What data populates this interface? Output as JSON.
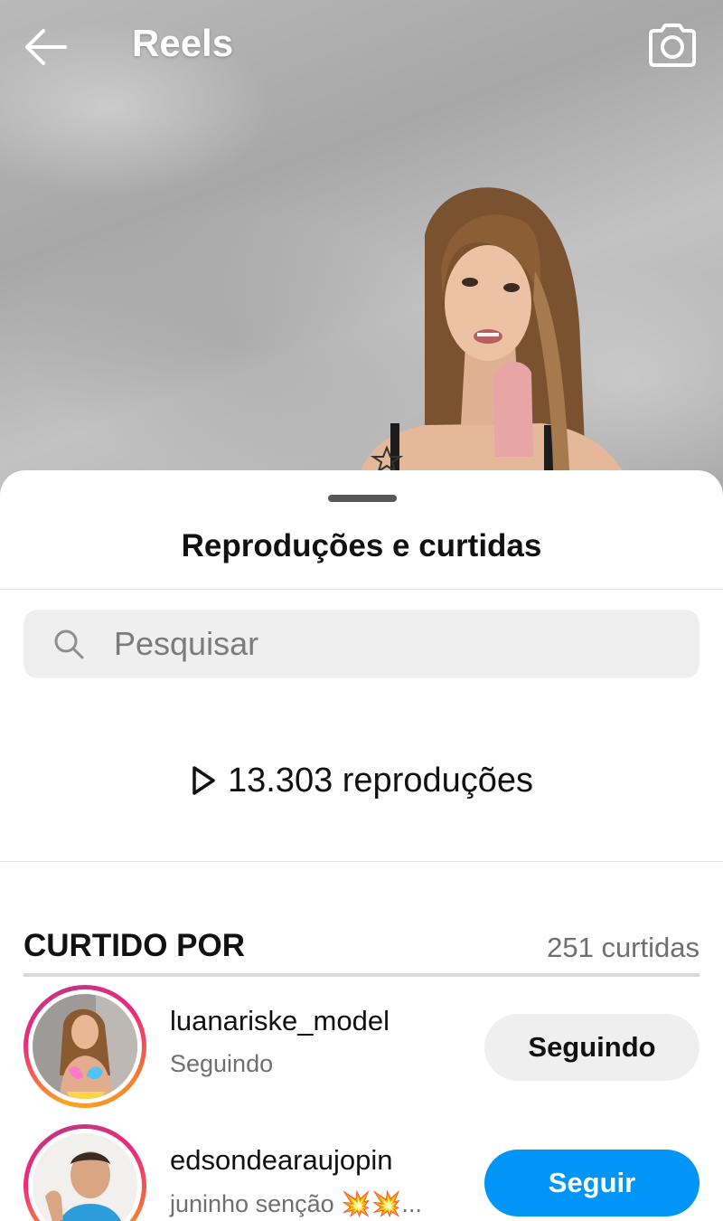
{
  "header": {
    "title": "Reels",
    "back_icon": "arrow-left-icon",
    "camera_icon": "camera-icon"
  },
  "sheet": {
    "title": "Reproduções e curtidas",
    "search": {
      "placeholder": "Pesquisar",
      "value": ""
    },
    "plays_text": "13.303 reproduções",
    "liked_by_header": "CURTIDO POR",
    "likes_count": "251 curtidas",
    "users": [
      {
        "username": "luanariske_model",
        "subtitle": "Seguindo",
        "button_label": "Seguindo",
        "following": true
      },
      {
        "username": "edsondearaujopin",
        "subtitle": "juninho senção 💥💥...",
        "button_label": "Seguir",
        "following": false
      }
    ]
  },
  "colors": {
    "follow_button": "#0095f6",
    "following_button": "#efefef",
    "story_ring_start": "#f9a825",
    "story_ring_end": "#c13584"
  }
}
